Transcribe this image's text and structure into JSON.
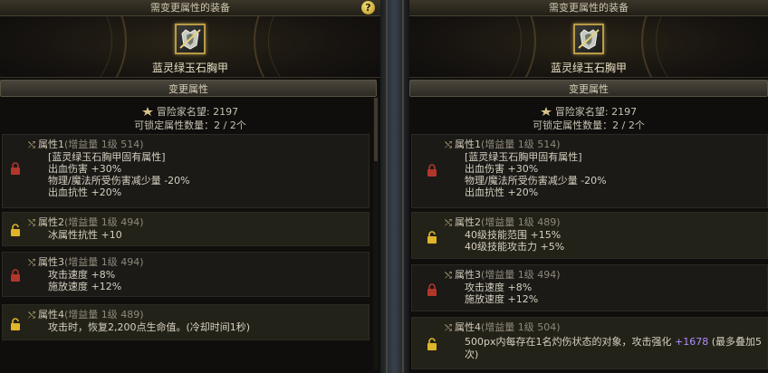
{
  "left": {
    "header_title": "需变更属性的装备",
    "help_label": "?",
    "equip_name": "蓝灵绿玉石胸甲",
    "section_title": "变更属性",
    "fame_label": "冒险家名望",
    "fame_value": ": 2197",
    "lockable_label": "可锁定属性数量：",
    "lockable_value": "2 / 2个",
    "attrs": [
      {
        "name": "属性1",
        "gain": "(增益量 1级 514)",
        "lock": "red",
        "lines": [
          "[蓝灵绿玉石胸甲固有属性]",
          "出血伤害 +30%",
          "物理/魔法所受伤害减少量 -20%",
          "出血抗性 +20%"
        ]
      },
      {
        "name": "属性2",
        "gain": "(增益量 1级 494)",
        "lock": "yellow",
        "lines": [
          "冰属性抗性 +10"
        ]
      },
      {
        "name": "属性3",
        "gain": "(增益量 1级 494)",
        "lock": "red",
        "lines": [
          "攻击速度 +8%",
          "施放速度 +12%"
        ]
      },
      {
        "name": "属性4",
        "gain": "(增益量 1级 489)",
        "lock": "yellow",
        "lines": [
          "攻击时，恢复2,200点生命值。(冷却时间1秒)"
        ]
      }
    ]
  },
  "right": {
    "header_title": "需变更属性的装备",
    "equip_name": "蓝灵绿玉石胸甲",
    "section_title": "变更属性",
    "fame_label": "冒险家名望",
    "fame_value": ": 2197",
    "lockable_label": "可锁定属性数量：",
    "lockable_value": "2 / 2个",
    "attrs": [
      {
        "name": "属性1",
        "gain": "(增益量 1级 514)",
        "lock": "red",
        "lines": [
          "[蓝灵绿玉石胸甲固有属性]",
          "出血伤害 +30%",
          "物理/魔法所受伤害减少量 -20%",
          "出血抗性 +20%"
        ]
      },
      {
        "name": "属性2",
        "gain": "(增益量 1级 489)",
        "lock": "yellow",
        "lines": [
          "40级技能范围 +15%",
          "40级技能攻击力 +5%"
        ]
      },
      {
        "name": "属性3",
        "gain": "(增益量 1级 494)",
        "lock": "red",
        "lines": [
          "攻击速度 +8%",
          "施放速度 +12%"
        ]
      },
      {
        "name": "属性4",
        "gain": "(增益量 1级 504)",
        "lock": "yellow",
        "line1_a": "500px内每存在1名灼伤状态的对象，攻击强化 ",
        "line1_b": "+1678",
        "line1_c": " (最多叠加5",
        "line2": "次)"
      }
    ]
  },
  "colors": {
    "lock_red": "#b3362b",
    "lock_yellow": "#e0b52a",
    "purple_value": "#b08cff"
  }
}
